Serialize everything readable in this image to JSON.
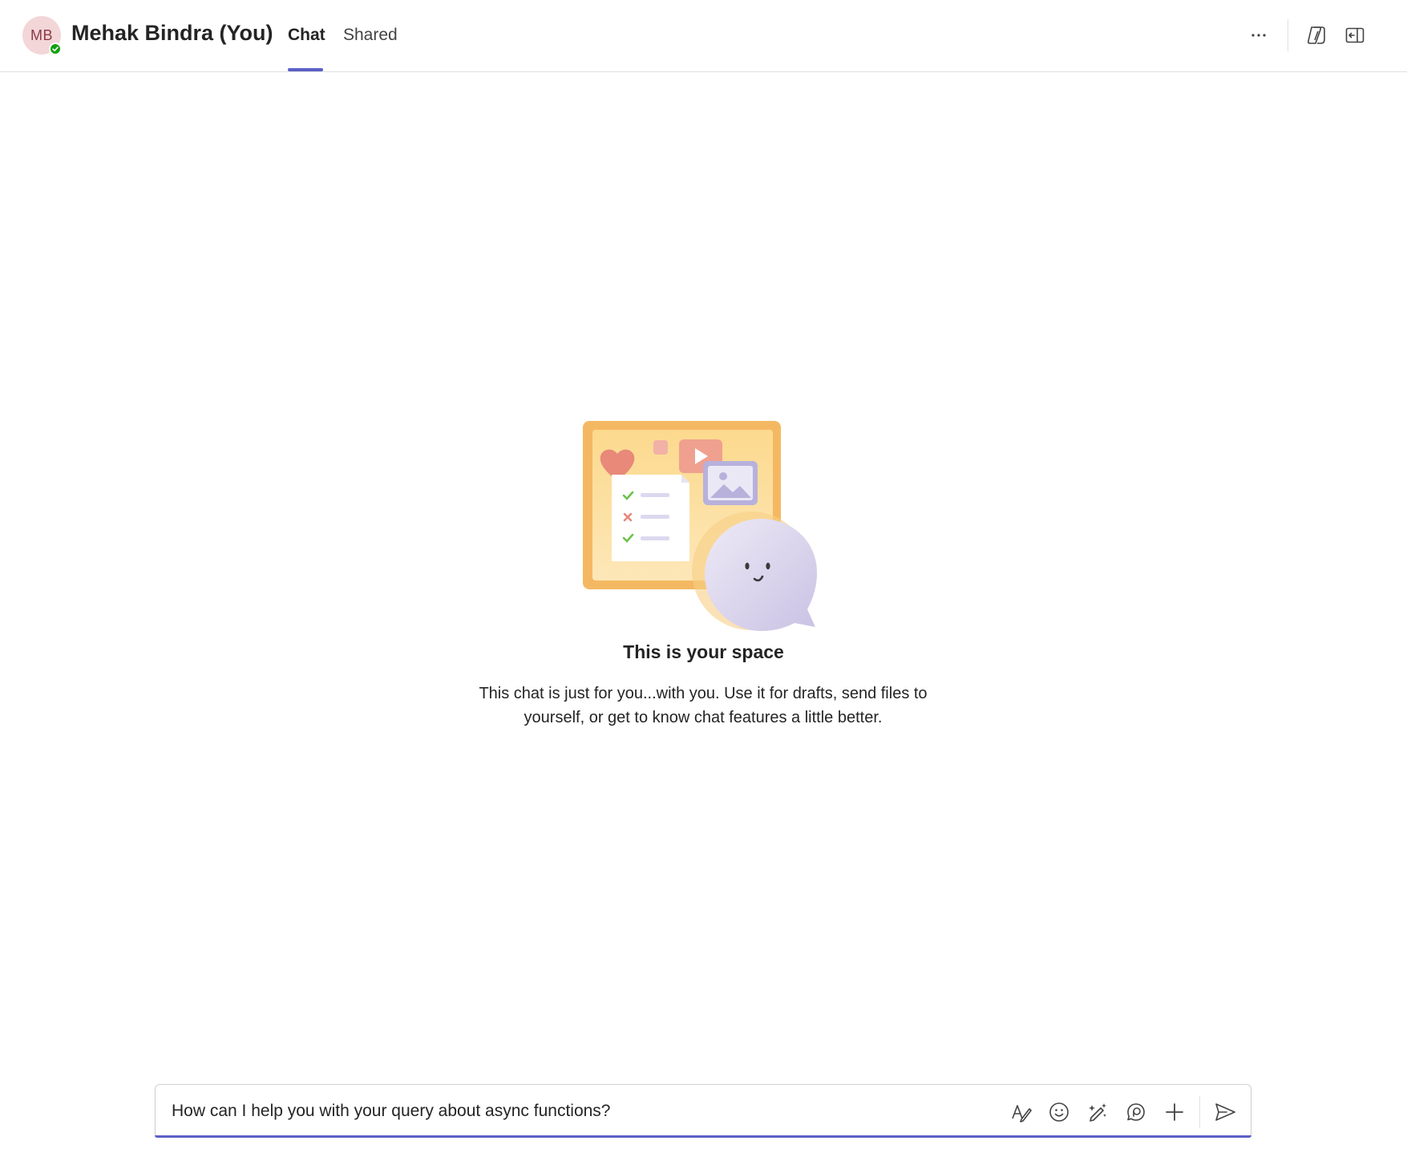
{
  "header": {
    "avatar_initials": "MB",
    "presence": "available",
    "title": "Mehak Bindra (You)",
    "tabs": [
      {
        "label": "Chat",
        "active": true
      },
      {
        "label": "Shared",
        "active": false
      }
    ],
    "icons": [
      "more-options-icon",
      "copilot-icon",
      "pop-out-chat-icon"
    ]
  },
  "empty_state": {
    "title": "This is your space",
    "description": "This chat is just for you...with you. Use it for drafts, send files to yourself, or get to know chat features a little better."
  },
  "compose": {
    "value": "How can I help you with your query about async functions?",
    "tools": [
      "format-icon",
      "emoji-icon",
      "ai-rewrite-icon",
      "loop-component-icon",
      "attach-plus-icon",
      "send-icon"
    ]
  },
  "colors": {
    "accent": "#5b5fc7",
    "presence_green": "#13a10e",
    "avatar_bg": "#f3d6d8",
    "avatar_text": "#8b3a48"
  }
}
